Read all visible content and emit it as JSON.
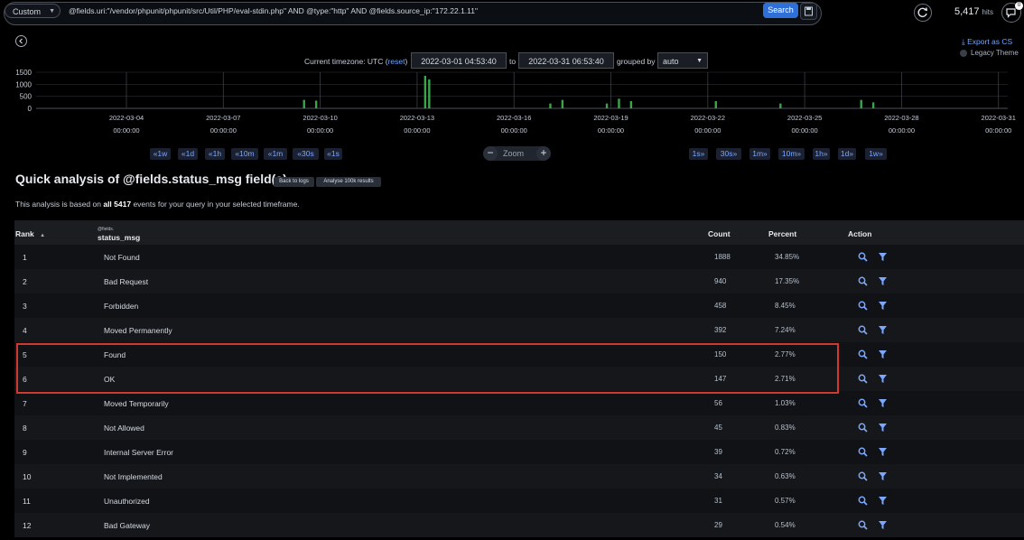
{
  "topbar": {
    "mode": "Custom",
    "query": "@fields.uri:\"/vendor/phpunit/phpunit/src/Util/PHP/eval-stdin.php\" AND @type:\"http\" AND @fields.source_ip:\"172.22.1.11\"",
    "search_label": "Search",
    "hits_value": "5,417",
    "hits_unit": "hits",
    "notif_count": "0"
  },
  "export_label": "Export as CS",
  "legacy_theme_label": "Legacy Theme",
  "timerange": {
    "tz_prefix": "Current timezone: UTC (",
    "tz_reset": "reset",
    "tz_suffix": ")",
    "from": "2022-03-01 04:53:40",
    "to_label": "to",
    "to": "2022-03-31 06:53:40",
    "grouped_label": "grouped by",
    "interval": "auto"
  },
  "chart_data": {
    "type": "bar",
    "ylim": [
      0,
      1500
    ],
    "y_ticks": [
      "1500",
      "1000",
      "500",
      "0"
    ],
    "x_labels": [
      {
        "date": "2022-03-04",
        "time": "00:00:00"
      },
      {
        "date": "2022-03-07",
        "time": "00:00:00"
      },
      {
        "date": "2022-03-10",
        "time": "00:00:00"
      },
      {
        "date": "2022-03-13",
        "time": "00:00:00"
      },
      {
        "date": "2022-03-16",
        "time": "00:00:00"
      },
      {
        "date": "2022-03-19",
        "time": "00:00:00"
      },
      {
        "date": "2022-03-22",
        "time": "00:00:00"
      },
      {
        "date": "2022-03-25",
        "time": "00:00:00"
      },
      {
        "date": "2022-03-28",
        "time": "00:00:00"
      },
      {
        "date": "2022-03-31",
        "time": "00:00:00"
      }
    ],
    "bars": [
      {
        "x": "2022-03-09 12:00",
        "y": 350
      },
      {
        "x": "2022-03-09 21:00",
        "y": 320
      },
      {
        "x": "2022-03-13 06:00",
        "y": 1350
      },
      {
        "x": "2022-03-13 09:00",
        "y": 1200
      },
      {
        "x": "2022-03-17 03:00",
        "y": 200
      },
      {
        "x": "2022-03-17 12:00",
        "y": 350
      },
      {
        "x": "2022-03-18 21:00",
        "y": 200
      },
      {
        "x": "2022-03-19 06:00",
        "y": 400
      },
      {
        "x": "2022-03-19 15:00",
        "y": 300
      },
      {
        "x": "2022-03-22 06:00",
        "y": 300
      },
      {
        "x": "2022-03-24 06:00",
        "y": 200
      },
      {
        "x": "2022-03-26 18:00",
        "y": 350
      },
      {
        "x": "2022-03-27 03:00",
        "y": 250
      }
    ]
  },
  "nav": {
    "back": [
      "«1w",
      "«1d",
      "«1h",
      "«10m",
      "«1m",
      "«30s",
      "«1s"
    ],
    "forward": [
      "1s»",
      "30s»",
      "1m»",
      "10m»",
      "1h»",
      "1d»",
      "1w»"
    ],
    "zoom_label": "Zoom",
    "zoom_minus": "−",
    "zoom_plus": "+"
  },
  "analysis": {
    "title": "Quick analysis of @fields.status_msg field(s)",
    "back_to_logs": "Back to logs",
    "analyse_100k": "Analyse 100k results",
    "note_prefix": "This analysis is based on",
    "note_count": "all 5417",
    "note_suffix": "events for your query in your selected timeframe."
  },
  "table": {
    "headers": {
      "rank": "Rank",
      "field_prefix": "@fields.",
      "field": "status_msg",
      "count": "Count",
      "percent": "Percent",
      "action": "Action"
    },
    "rows": [
      {
        "rank": "1",
        "value": "Not Found",
        "count": "1888",
        "percent": "34.85%"
      },
      {
        "rank": "2",
        "value": "Bad Request",
        "count": "940",
        "percent": "17.35%"
      },
      {
        "rank": "3",
        "value": "Forbidden",
        "count": "458",
        "percent": "8.45%"
      },
      {
        "rank": "4",
        "value": "Moved Permanently",
        "count": "392",
        "percent": "7.24%"
      },
      {
        "rank": "5",
        "value": "Found",
        "count": "150",
        "percent": "2.77%"
      },
      {
        "rank": "6",
        "value": "OK",
        "count": "147",
        "percent": "2.71%"
      },
      {
        "rank": "7",
        "value": "Moved Temporarily",
        "count": "56",
        "percent": "1.03%"
      },
      {
        "rank": "8",
        "value": "Not Allowed",
        "count": "45",
        "percent": "0.83%"
      },
      {
        "rank": "9",
        "value": "Internal Server Error",
        "count": "39",
        "percent": "0.72%"
      },
      {
        "rank": "10",
        "value": "Not Implemented",
        "count": "34",
        "percent": "0.63%"
      },
      {
        "rank": "11",
        "value": "Unauthorized",
        "count": "31",
        "percent": "0.57%"
      },
      {
        "rank": "12",
        "value": "Bad Gateway",
        "count": "29",
        "percent": "0.54%"
      }
    ]
  },
  "colors": {
    "bar": "#3aa64a",
    "accent": "#2f6fd8",
    "link": "#6fa6ff",
    "icon": "#7aa7ff",
    "highlight": "#d03a2e"
  }
}
